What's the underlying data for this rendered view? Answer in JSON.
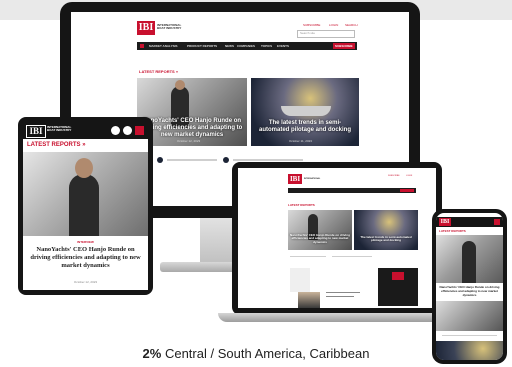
{
  "brand": {
    "logo": "IBI",
    "subtitle_1": "INTERNATIONAL",
    "subtitle_2": "BOAT INDUSTRY"
  },
  "header_links": [
    "SUBSCRIBE",
    "LOGIN",
    "SEARCH"
  ],
  "search": {
    "placeholder": "Search site"
  },
  "nav": [
    "MARKET ANALYSIS",
    "PRODUCT REPORTS",
    "NEWS",
    "COMPANIES",
    "TOPICS",
    "EVENTS"
  ],
  "nav_cta": "SUBSCRIBE",
  "section_title": "LATEST REPORTS",
  "section_arrow": "»",
  "articles": [
    {
      "title": "NanoYachts' CEO Hanjo Runde on driving efficiencies and adapting to new market dynamics",
      "date": "October 12, 2023",
      "category": "INTERVIEW"
    },
    {
      "title": "The latest trends in semi-automated pilotage and docking",
      "date": "October 11, 2023"
    }
  ],
  "tablet_heading": "LATEST REPORTS",
  "caption": {
    "percent": "2%",
    "text": "Central / South America, Caribbean"
  },
  "colors": {
    "brand_red": "#c8102e",
    "nav_dark": "#1c1c1c"
  }
}
